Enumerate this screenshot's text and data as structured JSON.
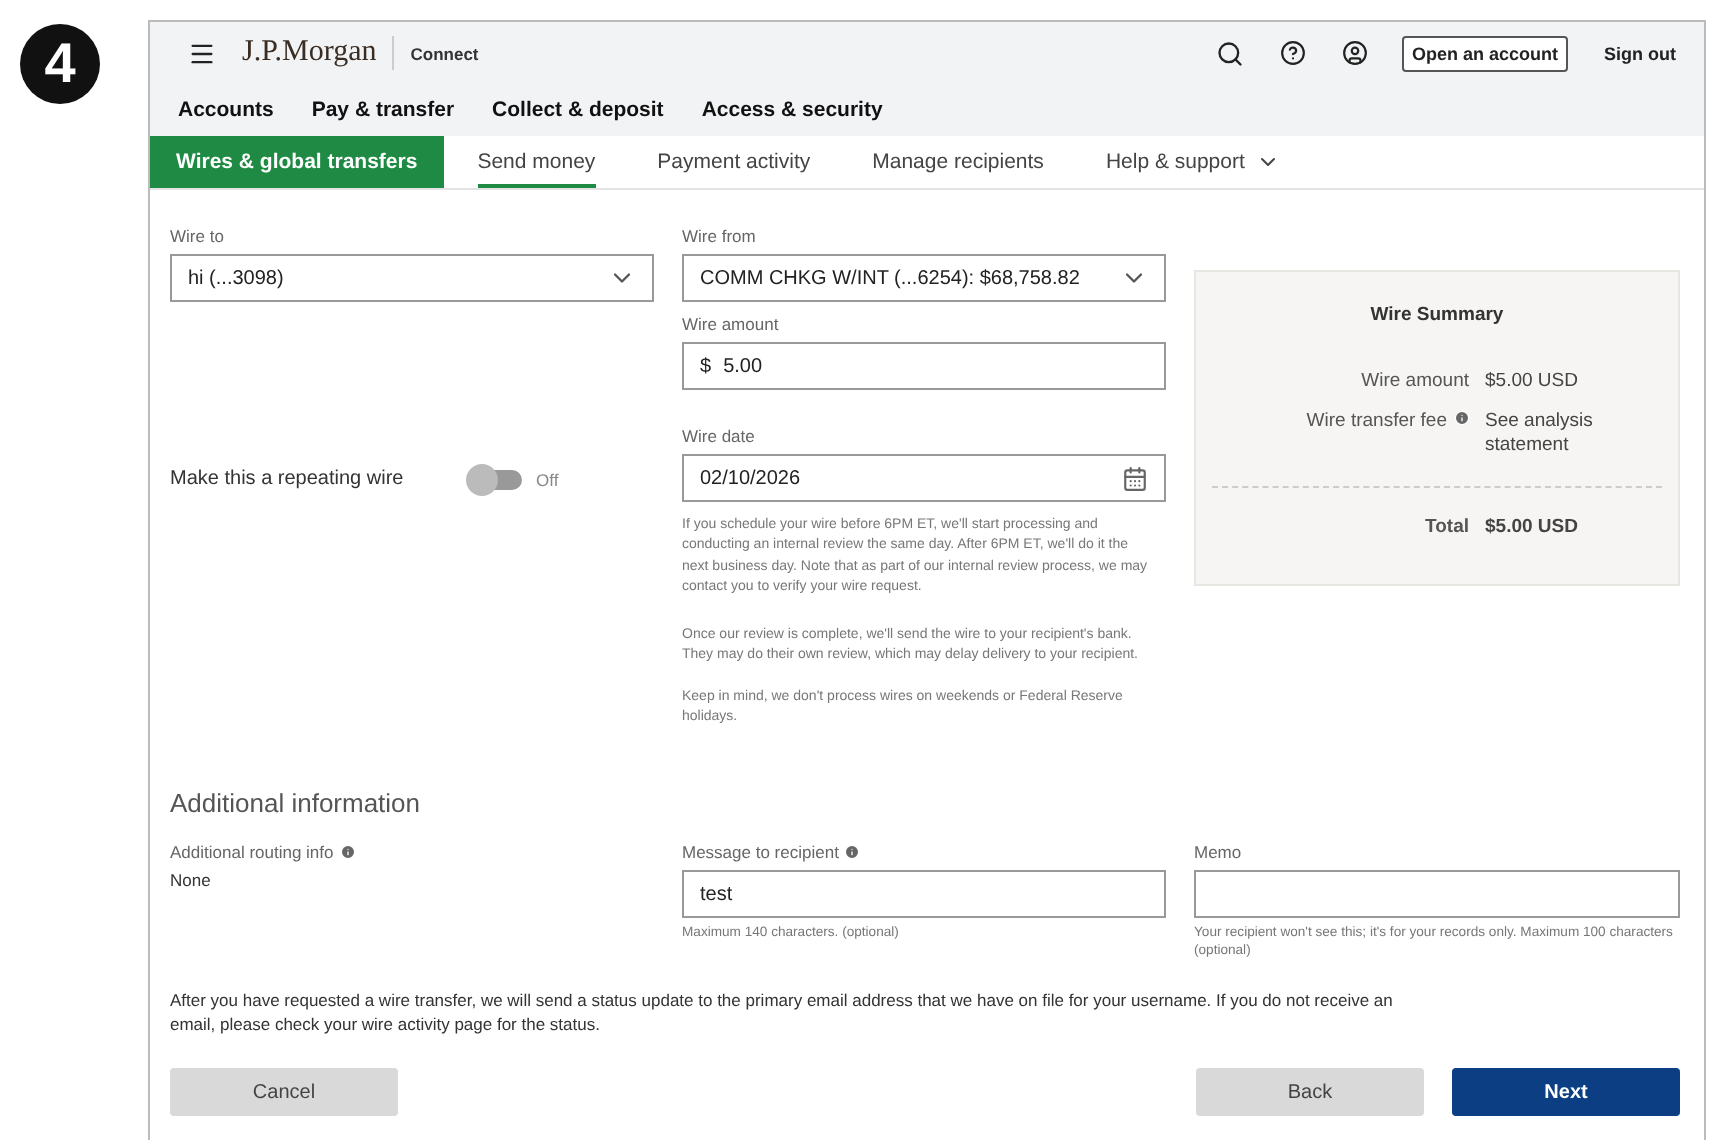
{
  "badge": "4",
  "header": {
    "logo": "J.P.Morgan",
    "product": "Connect",
    "open_account": "Open an account",
    "sign_out": "Sign out"
  },
  "main_nav": [
    {
      "label": "Accounts"
    },
    {
      "label": "Pay & transfer"
    },
    {
      "label": "Collect & deposit"
    },
    {
      "label": "Access & security"
    }
  ],
  "sub_nav": {
    "section": "Wires & global transfers",
    "tabs": [
      {
        "label": "Send money",
        "selected": true,
        "kind": "link"
      },
      {
        "label": "Payment activity",
        "selected": false,
        "kind": "link"
      },
      {
        "label": "Manage recipients",
        "selected": false,
        "kind": "link"
      },
      {
        "label": "Help & support",
        "selected": false,
        "kind": "dropdown"
      }
    ]
  },
  "wire_to": {
    "label": "Wire to",
    "value": "hi (...3098)"
  },
  "repeating": {
    "label": "Make this a repeating wire",
    "on": false,
    "state_text": "Off"
  },
  "wire_from": {
    "label": "Wire from",
    "value": "COMM CHKG W/INT (...6254): $68,758.82"
  },
  "wire_amount": {
    "label": "Wire amount",
    "currency": "$",
    "value": "5.00"
  },
  "wire_date": {
    "label": "Wire date",
    "value": "02/10/2026"
  },
  "notes": [
    "If you schedule your wire before 6PM ET, we'll start processing and conducting an internal review the same day. After 6PM ET, we'll do it the next business day. Note that as part of our internal review process, we may contact you to verify your wire request.",
    "Once our review is complete, we'll send the wire to your recipient's bank. They may do their own review, which may delay delivery to your recipient.",
    "Keep in mind, we don't process wires on weekends or Federal Reserve holidays."
  ],
  "summary": {
    "title": "Wire Summary",
    "rows": [
      {
        "label": "Wire amount",
        "value": "$5.00 USD",
        "info": false
      },
      {
        "label": "Wire transfer fee",
        "value": "See analysis statement",
        "info": true
      }
    ],
    "total": {
      "label": "Total",
      "value": "$5.00 USD"
    }
  },
  "additional": {
    "title": "Additional information",
    "routing": {
      "label": "Additional routing info",
      "info": true,
      "value": "None"
    },
    "message": {
      "label": "Message to recipient",
      "info": true,
      "value": "test",
      "hint": "Maximum 140 characters. (optional)"
    },
    "memo": {
      "label": "Memo",
      "info": false,
      "hint": "Your recipient won't see this; it's for your records only. Maximum 100 characters (optional)"
    }
  },
  "footer_text": "After you have requested a wire transfer, we will send a status update to the primary email address that we have on file for your username. If you do not receive an email, please check your wire activity page for the status.",
  "buttons": {
    "cancel": "Cancel",
    "back": "Back",
    "next": "Next"
  }
}
